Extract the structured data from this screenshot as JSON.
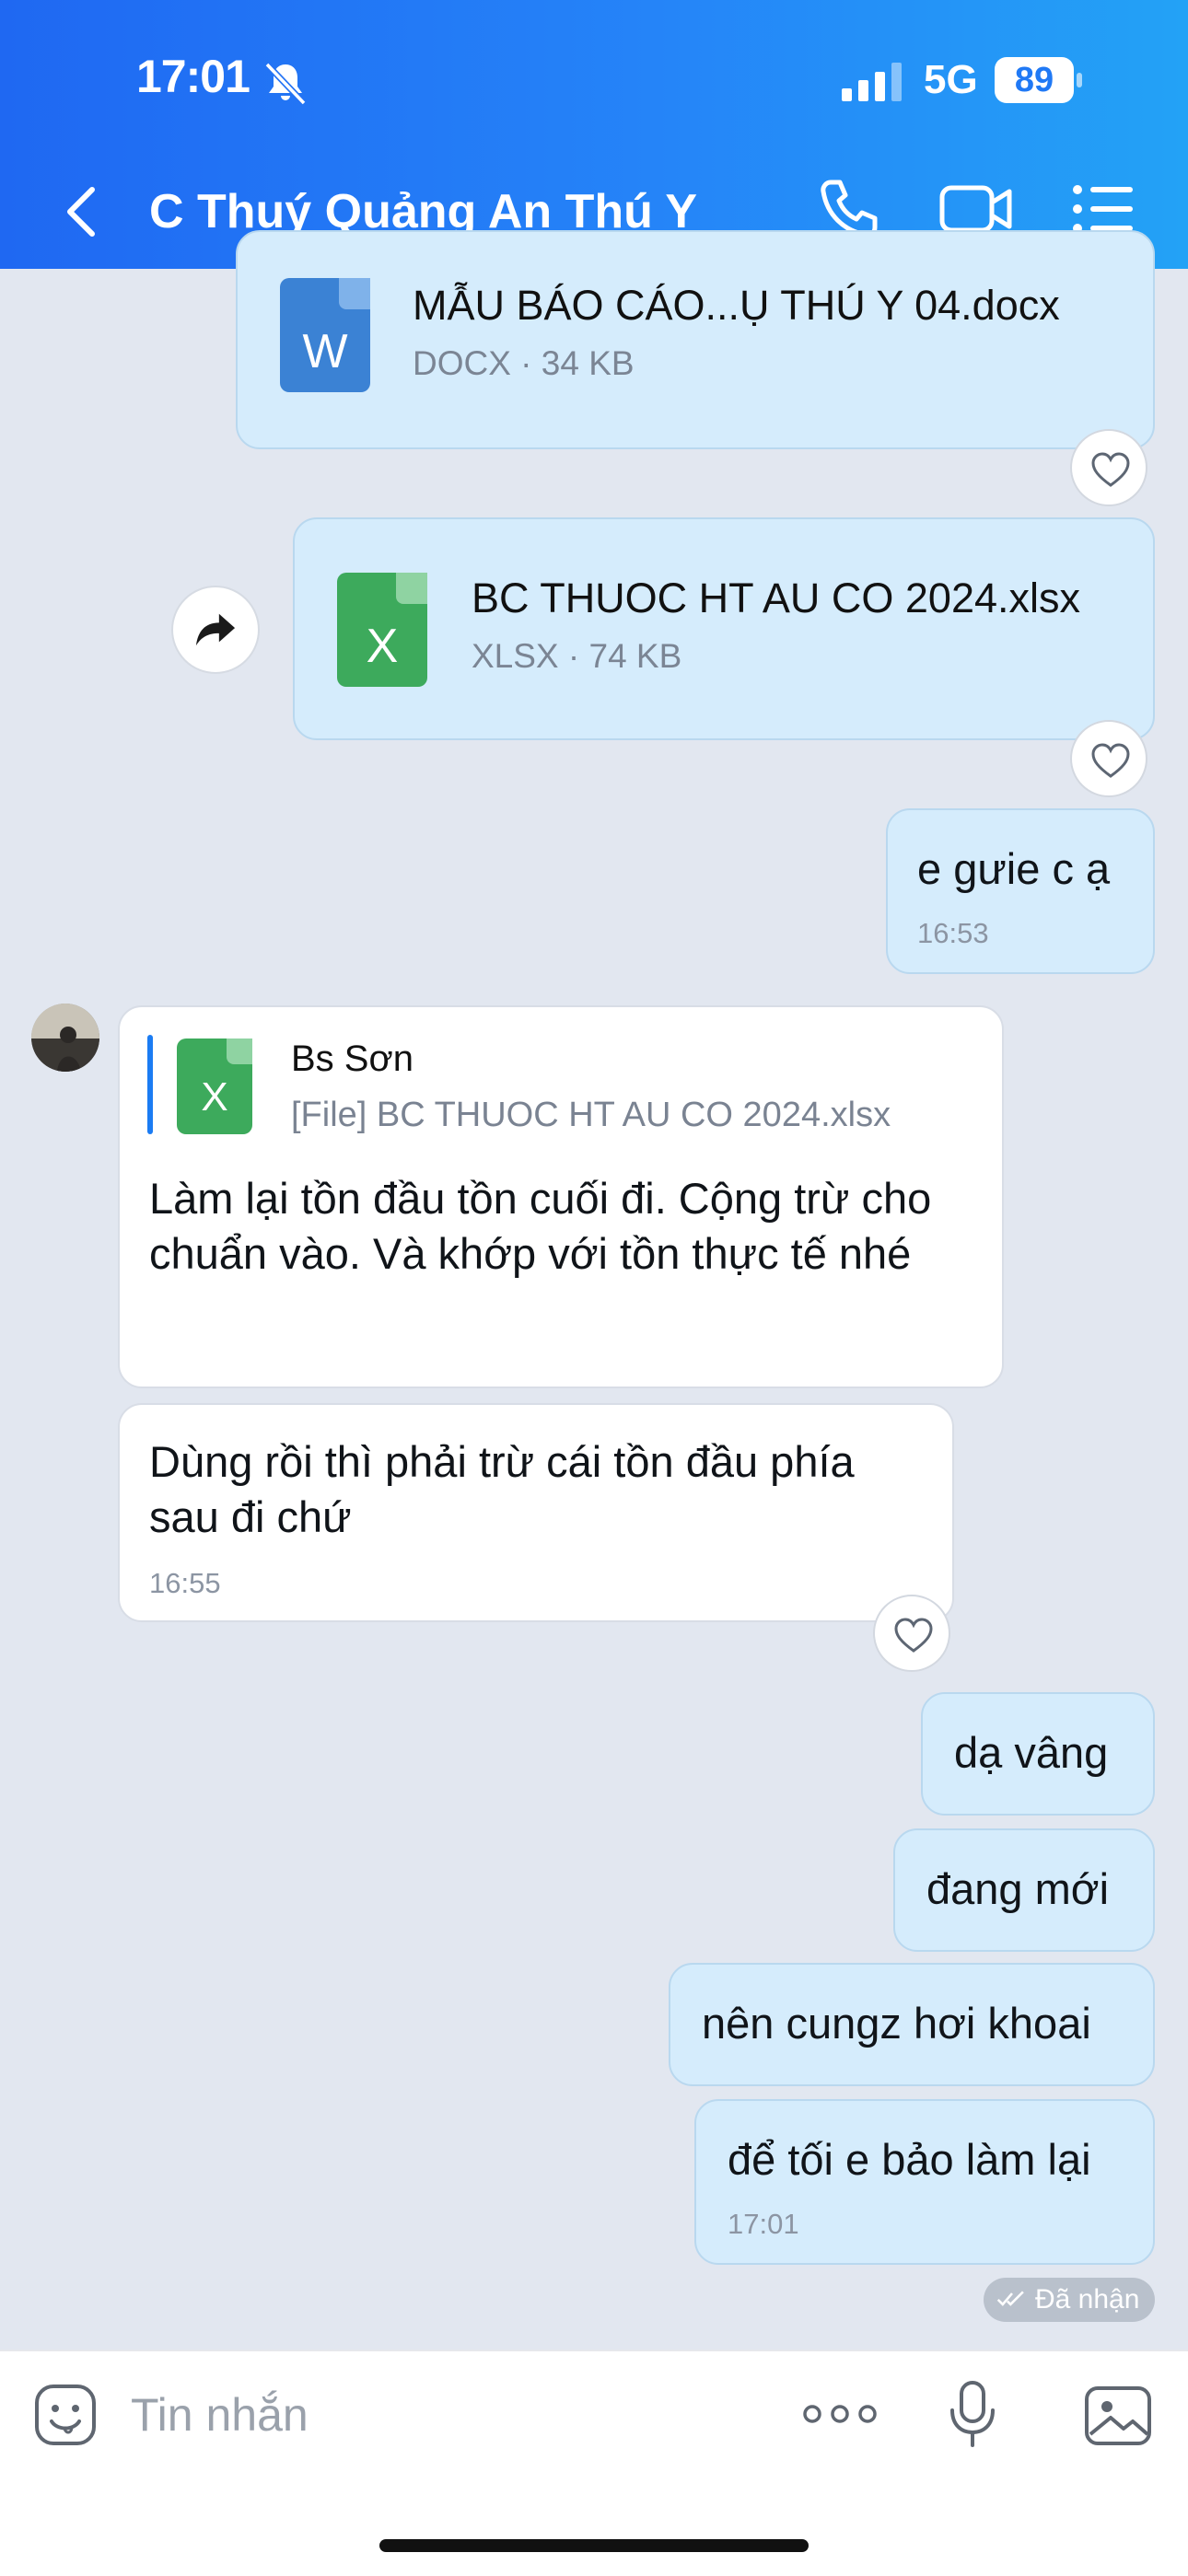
{
  "status_bar": {
    "time": "17:01",
    "network": "5G",
    "battery": "89"
  },
  "header": {
    "title": "C Thuý Quảng An Thú Y"
  },
  "messages": {
    "file1": {
      "name": "MẪU BÁO CÁO...Ụ THÚ Y 04.docx",
      "meta": "DOCX · 34 KB",
      "icon_letter": "W"
    },
    "file2": {
      "name": "BC THUOC HT AU CO 2024.xlsx",
      "meta": "XLSX · 74 KB",
      "icon_letter": "X"
    },
    "out1": {
      "text": "e gưie c ạ",
      "time": "16:53"
    },
    "in1": {
      "quote_sender": "Bs Sơn",
      "quote_file": "[File] BC THUOC HT AU CO 2024.xlsx",
      "quote_icon_letter": "X",
      "text": "Làm lại tồn đầu tồn cuối đi. Cộng trừ cho chuẩn vào. Và khớp với tồn thực tế nhé"
    },
    "in2": {
      "text": "Dùng rồi thì phải trừ cái tồn đầu phía sau đi chứ",
      "time": "16:55"
    },
    "out2": {
      "text": "dạ vâng"
    },
    "out3": {
      "text": "đang mới"
    },
    "out4": {
      "text": "nên cungz hơi khoai"
    },
    "out5": {
      "text": "để tối e bảo làm lại",
      "time": "17:01"
    },
    "status": "Đã nhận"
  },
  "input": {
    "placeholder": "Tin nhắn"
  },
  "colors": {
    "header_start": "#1f68f2",
    "header_end": "#23a2f6",
    "outgoing_bubble": "#d5ecfc",
    "incoming_bubble": "#ffffff",
    "word_icon": "#3b82d4",
    "excel_icon": "#3daa5c",
    "background": "#e2e7f0"
  }
}
